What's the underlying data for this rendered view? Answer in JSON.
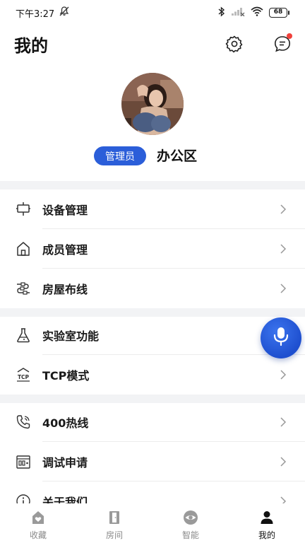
{
  "status_bar": {
    "time": "下午3:27",
    "battery": "68"
  },
  "header": {
    "title": "我的"
  },
  "profile": {
    "role": "管理员",
    "home_name": "办公区"
  },
  "menu": {
    "group1": [
      "设备管理",
      "成员管理",
      "房屋布线"
    ],
    "group2": [
      "实验室功能",
      "TCP模式"
    ],
    "group3": [
      "400热线",
      "调试申请",
      "关于我们"
    ]
  },
  "icons": {
    "device": "device-icon",
    "member": "house-icon",
    "wiring": "wiring-icon",
    "lab": "flask-icon",
    "tcp": "tcp-icon",
    "hotline": "phone-icon",
    "debug": "debug-request-icon",
    "about": "info-icon"
  },
  "tabs": [
    {
      "label": "收藏",
      "icon": "favorite-icon",
      "active": false
    },
    {
      "label": "房间",
      "icon": "room-door-icon",
      "active": false
    },
    {
      "label": "智能",
      "icon": "smart-icon",
      "active": false
    },
    {
      "label": "我的",
      "icon": "profile-icon",
      "active": true
    }
  ],
  "colors": {
    "accent": "#2b5ed9",
    "badge_dot": "#f0413b",
    "separator": "#f2f3f5"
  }
}
